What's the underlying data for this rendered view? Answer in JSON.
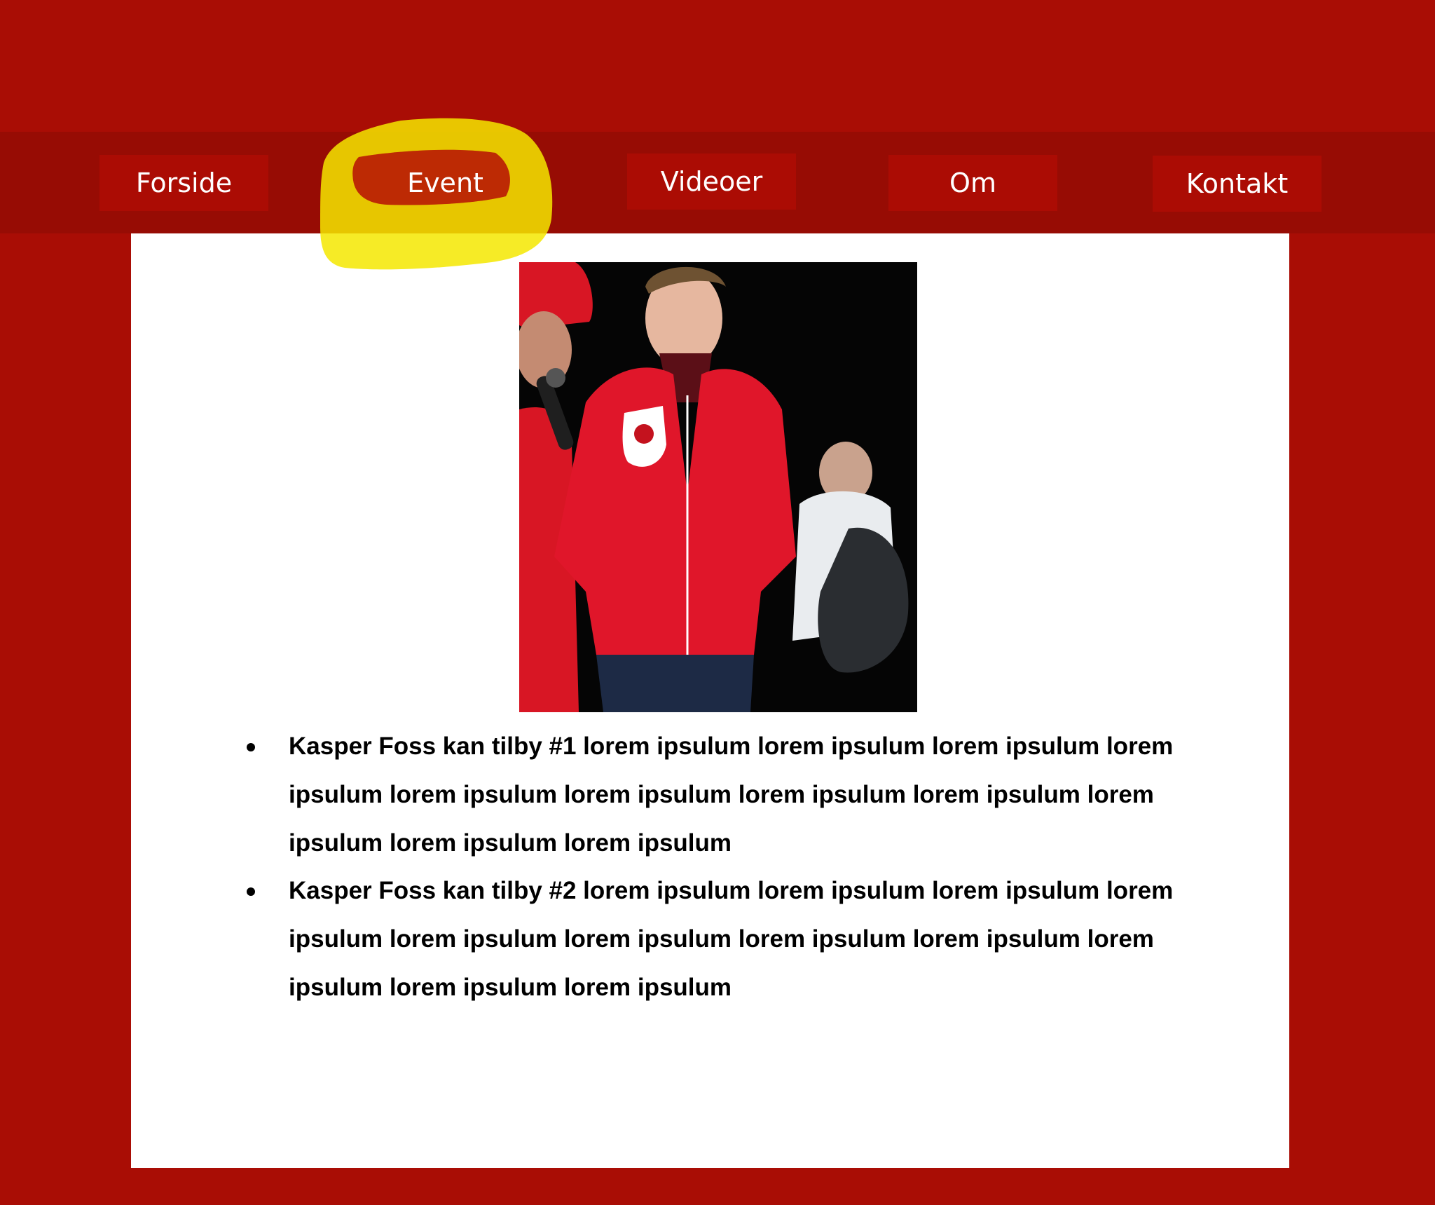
{
  "nav": {
    "items": [
      {
        "label": "Forside"
      },
      {
        "label": "Event"
      },
      {
        "label": "Videoer"
      },
      {
        "label": "Om"
      },
      {
        "label": "Kontakt"
      }
    ],
    "active": "Event"
  },
  "colors": {
    "background": "#a90d05",
    "nav_bar": "#970c04",
    "nav_button": "#ab0c04",
    "highlight": "#f5e800",
    "content_bg": "#ffffff",
    "text": "#000000"
  },
  "main": {
    "photo": {
      "icon": "event-photo-image"
    },
    "bullets": [
      {
        "text": "Kasper Foss kan tilby #1 lorem ipsulum lorem ipsulum lorem ipsulum lorem ipsulum lorem ipsulum lorem ipsulum lorem ipsulum lorem ipsulum lorem ipsulum lorem ipsulum lorem ipsulum"
      },
      {
        "text": "Kasper Foss kan tilby #2 lorem ipsulum lorem ipsulum lorem ipsulum lorem ipsulum lorem ipsulum lorem ipsulum lorem ipsulum lorem ipsulum lorem ipsulum lorem ipsulum lorem ipsulum"
      }
    ]
  }
}
